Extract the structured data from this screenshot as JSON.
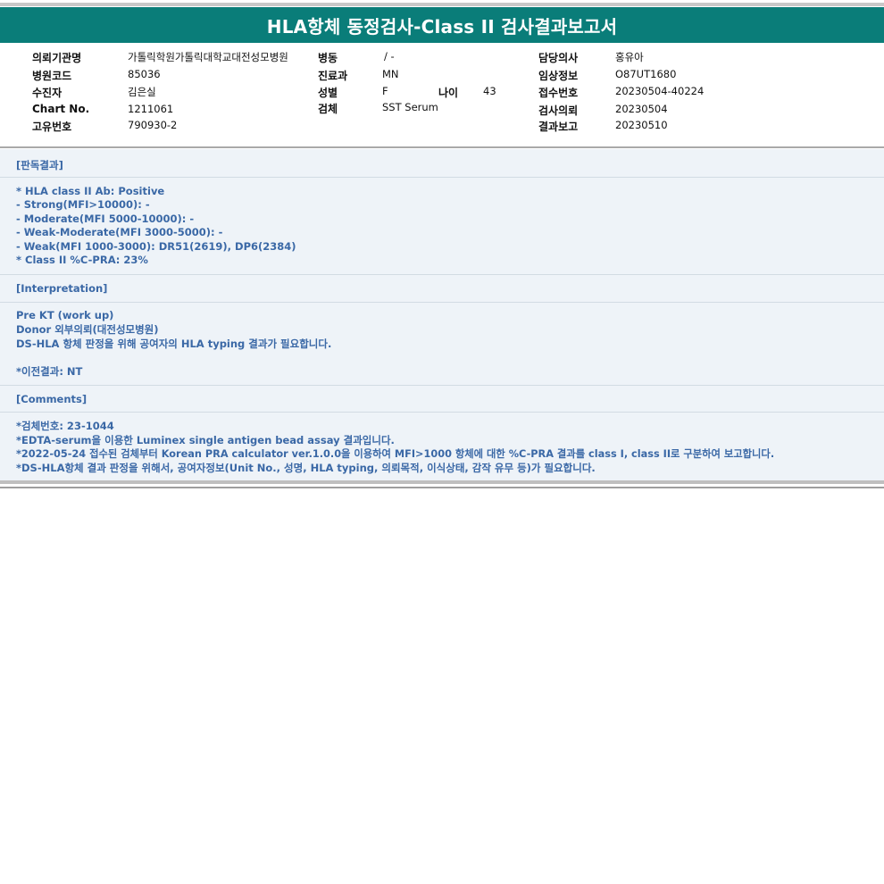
{
  "title": "HLA항체 동정검사-Class II 검사결과보고서",
  "patient_info": {
    "institution_label": "의뢰기관명",
    "institution_value": "가톨릭학원가톨릭대학교대전성모병원",
    "hospital_code_label": "병원코드",
    "hospital_code_value": "85036",
    "recipient_label": "수진자",
    "recipient_value": "김은실",
    "chart_no_label": "Chart No.",
    "chart_no_value": "1211061",
    "unique_no_label": "고유번호",
    "unique_no_value": "790930-2",
    "ward_label": "병동",
    "ward_value": "/ -",
    "department_label": "진료과",
    "department_value": "MN",
    "sex_label": "성별",
    "sex_value": "F",
    "age_label": "나이",
    "age_value": "43",
    "specimen_label": "검체",
    "specimen_value": "SST Serum",
    "doctor_label": "담당의사",
    "doctor_value": "홍유아",
    "clinical_info_label": "임상정보",
    "clinical_info_value": "O87UT1680",
    "receipt_no_label": "접수번호",
    "receipt_no_value": "20230504-40224",
    "request_date_label": "검사의뢰",
    "request_date_value": "20230504",
    "report_date_label": "결과보고",
    "report_date_value": "20230510"
  },
  "sections": {
    "result": {
      "header": "[판독결과]",
      "lines": [
        "* HLA class II Ab: Positive",
        "- Strong(MFI>10000): -",
        "- Moderate(MFI 5000-10000): -",
        "- Weak-Moderate(MFI 3000-5000): -",
        "- Weak(MFI 1000-3000): DR51(2619), DP6(2384)",
        "* Class II %C-PRA: 23%"
      ]
    },
    "interpretation": {
      "header": "[Interpretation]",
      "lines": [
        "Pre KT (work up)",
        "Donor 외부의뢰(대전성모병원)",
        "DS-HLA 항체 판정을 위해 공여자의 HLA typing 결과가 필요합니다.",
        "*이전결과: NT"
      ]
    },
    "comments": {
      "header": "[Comments]",
      "lines": [
        "*검체번호: 23-1044",
        "*EDTA-serum을 이용한 Luminex single antigen bead assay 결과입니다.",
        "*2022-05-24 접수된 검체부터 Korean PRA calculator ver.1.0.0을 이용하여 MFI>1000 항체에 대한 %C-PRA 결과를 class I, class II로 구분하여 보고합니다.",
        "*DS-HLA항체 결과 판정을 위해서, 공여자정보(Unit No., 성명, HLA typing, 의뢰목적, 이식상태, 감작 유무 등)가 필요합니다."
      ]
    }
  },
  "colors": {
    "title_bar": "#0a7d79",
    "section_text": "#3a68a6",
    "results_bg": "#eef3f8"
  }
}
